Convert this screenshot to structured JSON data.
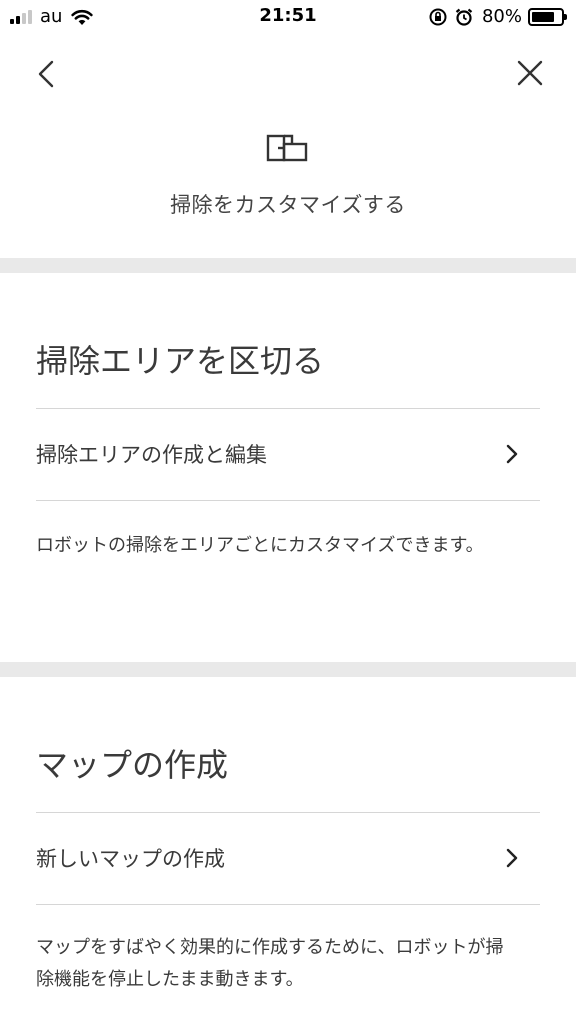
{
  "status_bar": {
    "carrier": "au",
    "time": "21:51",
    "battery_percent": "80%",
    "battery_level": 0.8,
    "signal_bars_active": 2,
    "signal_bars_total": 4
  },
  "header": {
    "title": "掃除をカスタマイズする",
    "icon": "floor-plan-icon"
  },
  "sections": [
    {
      "title": "掃除エリアを区切る",
      "item_label": "掃除エリアの作成と編集",
      "description": "ロボットの掃除をエリアごとにカスタマイズできます。"
    },
    {
      "title": "マップの作成",
      "item_label": "新しいマップの作成",
      "description": "マップをすばやく効果的に作成するために、ロボットが掃除機能を停止したまま動きます。"
    }
  ],
  "colors": {
    "background": "#ffffff",
    "band": "#e9e9e9",
    "text": "#3a3a3a",
    "divider": "#d6d6d6"
  }
}
